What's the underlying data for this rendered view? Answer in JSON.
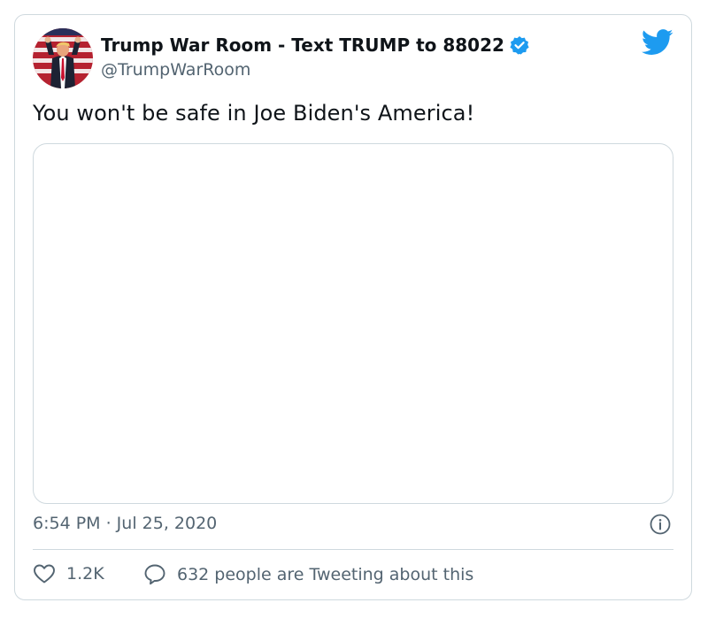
{
  "tweet": {
    "author_name": "Trump War Room - Text TRUMP to 88022",
    "handle": "@TrumpWarRoom",
    "text": "You won't be safe in Joe Biden's America!",
    "timestamp": "6:54 PM · Jul 25, 2020",
    "likes": "1.2K",
    "conversation": "632 people are Tweeting about this"
  },
  "icons": {
    "verified": "verified-badge-icon",
    "brand": "twitter-bird-icon",
    "info": "info-icon",
    "like": "heart-icon",
    "reply": "speech-bubble-icon"
  },
  "colors": {
    "brand": "#1d9bf0",
    "secondary_text": "#536471",
    "border": "#cfd9de"
  }
}
